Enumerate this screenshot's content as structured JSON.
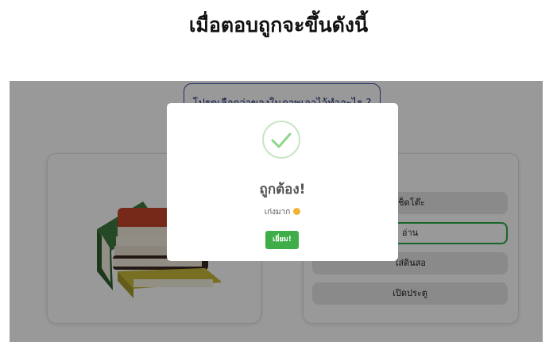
{
  "heading": "เมื่อตอบถูกจะขึ้นดังนี้",
  "question": "โปรดเลือกว่าของในภาพเอาไว้ทำอะไร ?",
  "options": [
    "เช็ดโต๊ะ",
    "อ่าน",
    "ใส่ดินสอ",
    "เปิดประตู"
  ],
  "selected_option_index": 1,
  "modal": {
    "title": "ถูกต้อง!",
    "text": "เก่งมาก",
    "confirm_label": "เยี่ยม!"
  },
  "colors": {
    "selected_border": "#2aa84a",
    "confirm_button": "#3fae49",
    "check_icon": "#8fd58a",
    "question_border": "#3a4fa0"
  },
  "icons": [
    "check-icon",
    "books-illustration",
    "emoji-icon"
  ]
}
